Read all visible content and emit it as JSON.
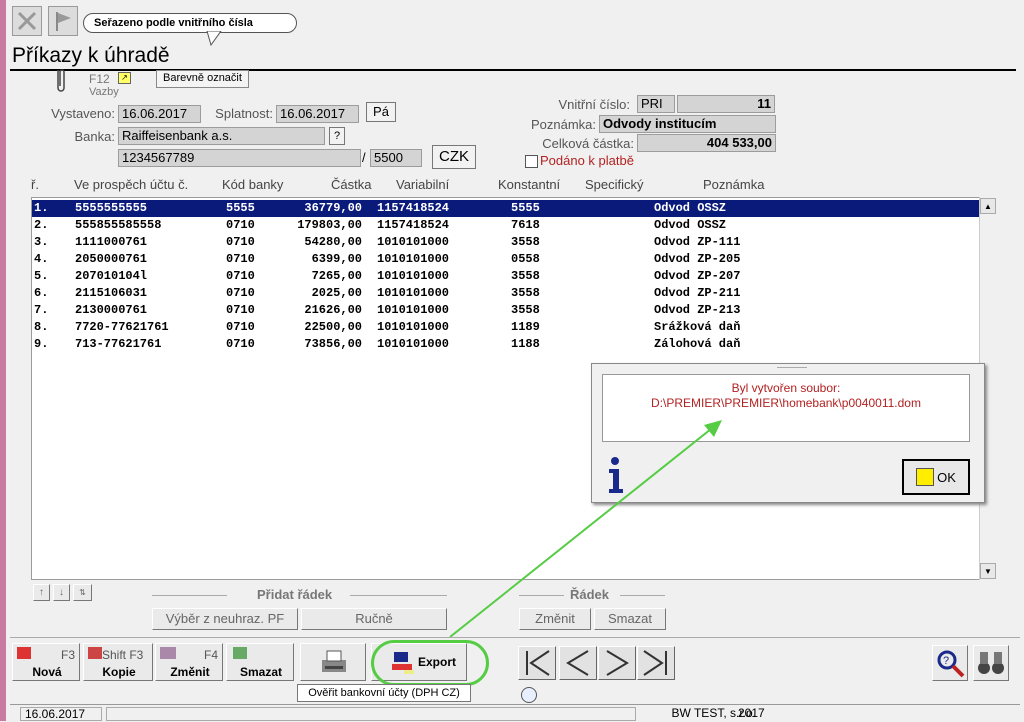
{
  "window": {
    "tooltip": "Seřazeno podle vnitřního čísla",
    "title": "Příkazy k úhradě",
    "f12_label": "F12",
    "vazby_label": "Vazby",
    "barevne_label": "Barevně označit"
  },
  "form": {
    "vystaveno_label": "Vystaveno:",
    "vystaveno_value": "16.06.2017",
    "splatnost_label": "Splatnost:",
    "splatnost_value": "16.06.2017",
    "day_button": "Pá",
    "banka_label": "Banka:",
    "banka_value": "Raiffeisenbank a.s.",
    "lookup_button": "?",
    "account_value": "1234567789",
    "slash": "/",
    "bank_code_value": "5500",
    "currency_button": "CZK",
    "vnitrni_label": "Vnitřní číslo:",
    "vnitrni_prefix": "PRI",
    "vnitrni_value": "11",
    "poznamka_label": "Poznámka:",
    "poznamka_value": "Odvody institucím",
    "celkova_label": "Celková částka:",
    "celkova_value": "404 533,00",
    "podano_label": "Podáno k platbě"
  },
  "table": {
    "headers": [
      "ř.",
      "Ve prospěch účtu č.",
      "Kód banky",
      "Částka",
      "Variabilní",
      "Konstantní",
      "Specifický",
      "Poznámka"
    ],
    "rows": [
      {
        "n": "1.",
        "ucet": "5555555555",
        "kod": "5555",
        "castka": "36779,00",
        "vs": "1157418524",
        "ks": "5555",
        "ss": "",
        "pozn": "Odvod OSSZ"
      },
      {
        "n": "2.",
        "ucet": "555855585558",
        "kod": "0710",
        "castka": "179803,00",
        "vs": "1157418524",
        "ks": "7618",
        "ss": "",
        "pozn": "Odvod OSSZ"
      },
      {
        "n": "3.",
        "ucet": "1111000761",
        "kod": "0710",
        "castka": "54280,00",
        "vs": "1010101000",
        "ks": "3558",
        "ss": "",
        "pozn": "Odvod ZP-111"
      },
      {
        "n": "4.",
        "ucet": "2050000761",
        "kod": "0710",
        "castka": "6399,00",
        "vs": "1010101000",
        "ks": "0558",
        "ss": "",
        "pozn": "Odvod ZP-205"
      },
      {
        "n": "5.",
        "ucet": "207010104l",
        "kod": "0710",
        "castka": "7265,00",
        "vs": "1010101000",
        "ks": "3558",
        "ss": "",
        "pozn": "Odvod ZP-207"
      },
      {
        "n": "6.",
        "ucet": "2115106031",
        "kod": "0710",
        "castka": "2025,00",
        "vs": "1010101000",
        "ks": "3558",
        "ss": "",
        "pozn": "Odvod ZP-211"
      },
      {
        "n": "7.",
        "ucet": "2130000761",
        "kod": "0710",
        "castka": "21626,00",
        "vs": "1010101000",
        "ks": "3558",
        "ss": "",
        "pozn": "Odvod ZP-213"
      },
      {
        "n": "8.",
        "ucet": "7720-77621761",
        "kod": "0710",
        "castka": "22500,00",
        "vs": "1010101000",
        "ks": "1189",
        "ss": "",
        "pozn": "Srážková daň"
      },
      {
        "n": "9.",
        "ucet": "713-77621761",
        "kod": "0710",
        "castka": "73856,00",
        "vs": "1010101000",
        "ks": "1188",
        "ss": "",
        "pozn": "Zálohová daň"
      }
    ]
  },
  "dialog": {
    "line1": "Byl vytvořen soubor:",
    "line2": "D:\\PREMIER\\PREMIER\\homebank\\p0040011.dom",
    "ok_label": "OK",
    "icon": "info-icon"
  },
  "sections": {
    "pridat_label": "Přidat řádek",
    "vyber_button": "Výběr z neuhraz. PF",
    "rucne_button": "Ručně",
    "radek_label": "Řádek",
    "zmenit_button": "Změnit",
    "smazat_button": "Smazat"
  },
  "toolbar": {
    "nova_key": "F3",
    "nova_label": "Nová",
    "kopie_key": "Shift F3",
    "kopie_label": "Kopie",
    "zmenit_key": "F4",
    "zmenit_label": "Změnit",
    "smazat_label": "Smazat",
    "export_label": "Export",
    "overit_label": "Ověřit bankovní účty (DPH CZ)"
  },
  "status": {
    "date": "16.06.2017",
    "company": "BW TEST, s.r.o.",
    "year": "2017"
  },
  "colors": {
    "selection": "#0a1a7a",
    "highlight_green": "#55cc44",
    "message_red": "#b22222"
  }
}
